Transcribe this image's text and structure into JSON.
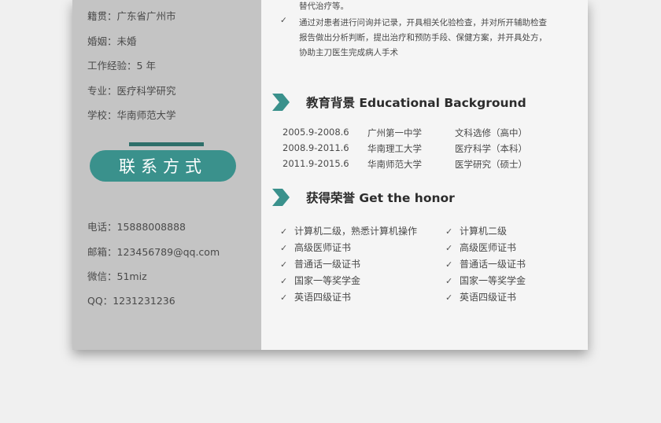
{
  "sidebar": {
    "info": [
      {
        "label": "籍贯：",
        "value": "广东省广州市"
      },
      {
        "label": "婚姻：",
        "value": "未婚"
      },
      {
        "label": "工作经验：",
        "value": "5 年"
      },
      {
        "label": "专业：",
        "value": "医疗科学研究"
      },
      {
        "label": "学校：",
        "value": "华南师范大学"
      }
    ],
    "contact_title": "联系方式",
    "contacts": [
      {
        "label": "电话：",
        "value": "15888008888"
      },
      {
        "label": "邮箱：",
        "value": "123456789@qq.com"
      },
      {
        "label": "微信：",
        "value": "51miz"
      },
      {
        "label": "QQ：",
        "value": "1231231236"
      }
    ]
  },
  "work": {
    "top_line": "替代治疗等。",
    "item_lines": [
      "通过对患者进行问询并记录，开具相关化验检查，并对所开辅助检查",
      "报告做出分析判断，提出治疗和预防手段、保健方案，并开具处方，",
      "协助主刀医生完成病人手术"
    ]
  },
  "education": {
    "title": "教育背景 Educational Background",
    "rows": [
      {
        "period": "2005.9-2008.6",
        "school": "广州第一中学",
        "major": "文科选修（高中）"
      },
      {
        "period": "2008.9-2011.6",
        "school": "华南理工大学",
        "major": "医疗科学（本科）"
      },
      {
        "period": "2011.9-2015.6",
        "school": "华南师范大学",
        "major": "医学研究（硕士）"
      }
    ]
  },
  "honors": {
    "title": "获得荣誉 Get the honor",
    "left": [
      "计算机二级，熟悉计算机操作",
      "高级医师证书",
      "普通话一级证书",
      "国家一等奖学金",
      "英语四级证书"
    ],
    "right": [
      "计算机二级",
      "高级医师证书",
      "普通话一级证书",
      "国家一等奖学金",
      "英语四级证书"
    ]
  },
  "colors": {
    "accent": "#3a918c",
    "sidebar": "#c4c4c4"
  }
}
